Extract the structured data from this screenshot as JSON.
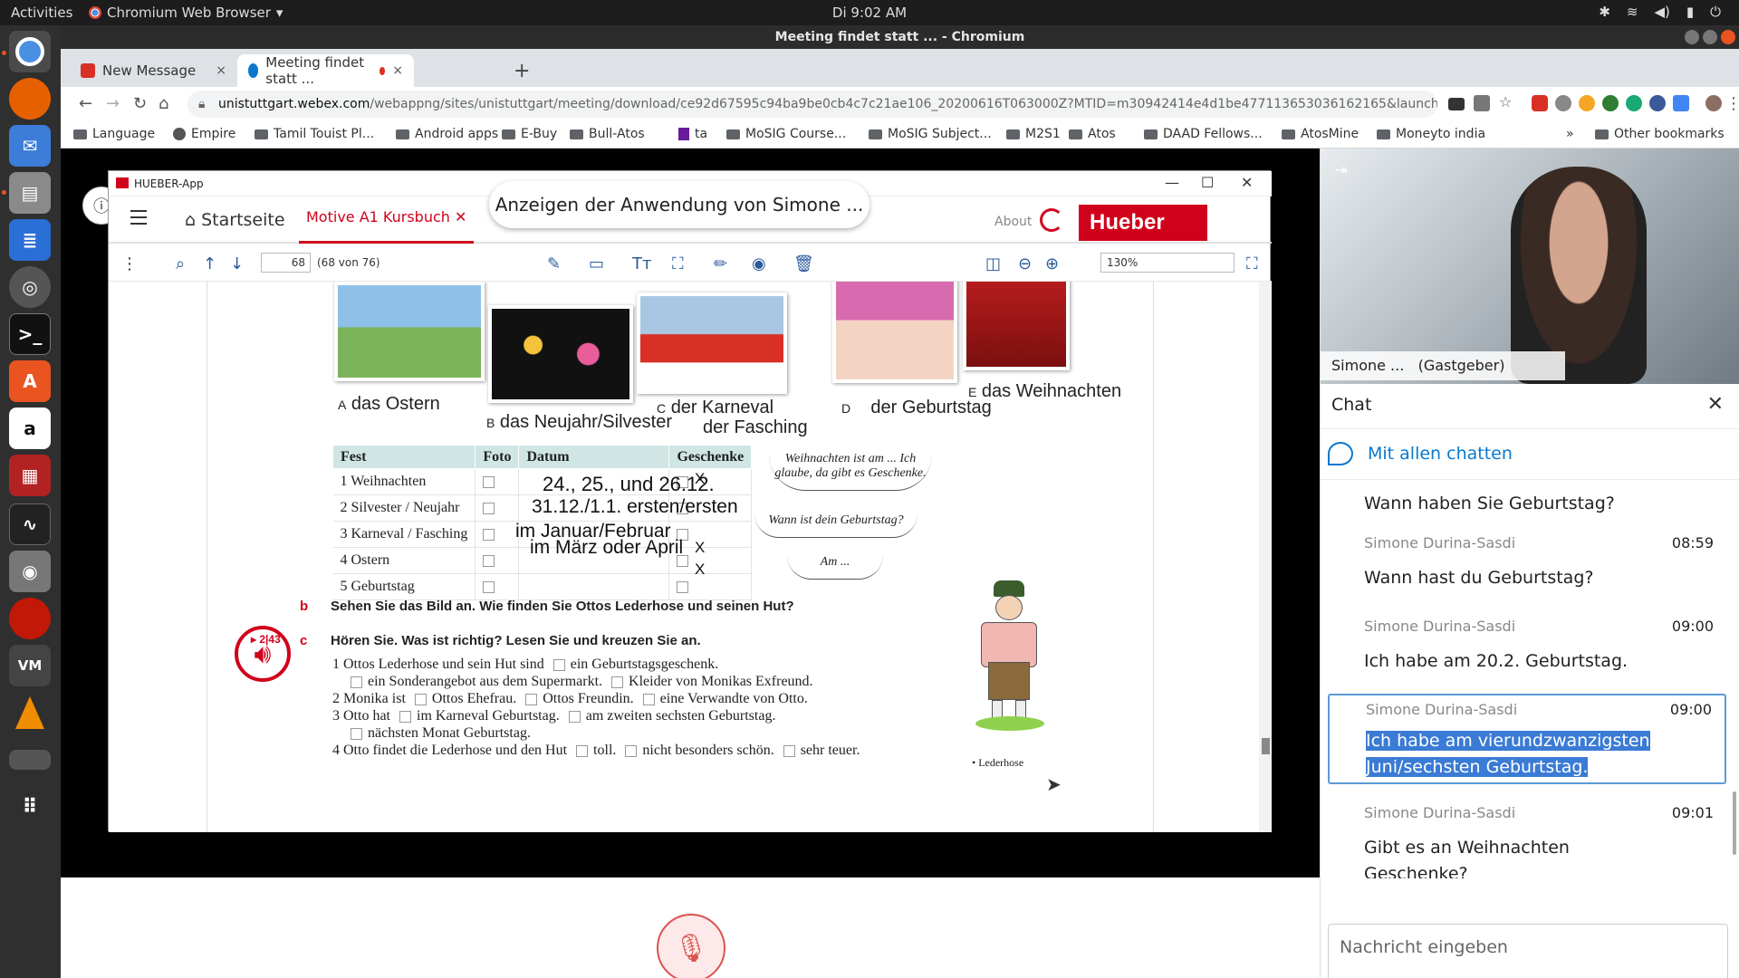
{
  "system": {
    "activities": "Activities",
    "app_menu": "Chromium Web Browser",
    "clock": "Di  9:02 AM"
  },
  "window": {
    "title": "Meeting findet statt ... - Chromium"
  },
  "tabs": [
    {
      "label": "New Message",
      "close": "×"
    },
    {
      "label": "Meeting findet statt ...",
      "close": "×"
    }
  ],
  "newtab": "+",
  "address": {
    "host": "unistuttgart.webex.com",
    "path": "/webappng/sites/unistuttgart/meeting/download/ce92d67595c94ba9be0cb4c7c21ae106_20200616T063000Z?MTID=m30942414e4d1be477113653036162165&launchApp..."
  },
  "bookmarks": [
    "Language",
    "Empire",
    "Tamil Touist Pl...",
    "Android apps",
    "E-Buy",
    "Bull-Atos",
    "ta",
    "MoSIG Course...",
    "MoSIG Subject...",
    "M2S1",
    "Atos",
    "DAAD Fellows...",
    "AtosMine",
    "Moneyto india"
  ],
  "bookmarks_more": "»",
  "other_bookmarks": "Other bookmarks",
  "share_banner": "Anzeigen der Anwendung von Simone ...",
  "hueber": {
    "title": "HUEBER-App",
    "home": "Startseite",
    "course": "Motive A1 Kursbuch",
    "about": "About",
    "brand": "Hueber",
    "page_number": "68",
    "page_of": "(68 von 76)",
    "zoom": "130%"
  },
  "doc": {
    "captions": [
      {
        "letter": "A",
        "text": "das Ostern"
      },
      {
        "letter": "B",
        "text": "das Neujahr/Silvester"
      },
      {
        "letter": "C",
        "text": "der Karneval"
      },
      {
        "letter": "",
        "text": "der Fasching"
      },
      {
        "letter": "D",
        "text": "der Geburtstag"
      },
      {
        "letter": "E",
        "text": "das Weihnachten"
      }
    ],
    "table_headers": [
      "Fest",
      "Foto",
      "Datum",
      "Geschenke"
    ],
    "table_rows": [
      {
        "fest": "1  Weihnachten",
        "datum": "24., 25., und 26.12.",
        "geschenke": "X"
      },
      {
        "fest": "2  Silvester / Neujahr",
        "datum": "31.12./1.1. ersten/ersten",
        "geschenke": ""
      },
      {
        "fest": "3  Karneval / Fasching",
        "datum": "im Januar/Februar",
        "geschenke": ""
      },
      {
        "fest": "4  Ostern",
        "datum": "im März oder April",
        "geschenke": "X"
      },
      {
        "fest": "5  Geburtstag",
        "datum": "",
        "geschenke": "X"
      }
    ],
    "bubbles": [
      "Weihnachten ist am ... Ich glaube, da gibt es Geschenke.",
      "Wann ist dein Geburtstag?",
      "Am ..."
    ],
    "task_b_letter": "b",
    "task_b": "Sehen Sie das Bild an. Wie finden Sie Ottos Lederhose und seinen Hut?",
    "task_c_track": "▸ 2|43",
    "task_c_letter": "c",
    "task_c": "Hören Sie. Was ist richtig? Lesen Sie und kreuzen Sie an.",
    "q1": "1  Ottos Lederhose und sein Hut sind",
    "q1a": "ein Geburtstagsgeschenk.",
    "q1b": "ein Sonderangebot aus dem Supermarkt.",
    "q1c": "Kleider von Monikas Exfreund.",
    "q2": "2  Monika ist",
    "q2a": "Ottos Ehefrau.",
    "q2b": "Ottos Freundin.",
    "q2c": "eine Verwandte von Otto.",
    "q3": "3  Otto hat",
    "q3a": "im Karneval Geburtstag.",
    "q3b": "am zweiten sechsten Geburtstag.",
    "q3c": "nächsten Monat Geburtstag.",
    "q4": "4  Otto findet die Lederhose und den Hut",
    "q4a": "toll.",
    "q4b": "nicht besonders schön.",
    "q4c": "sehr teuer.",
    "figure_label": "• Lederhose"
  },
  "video": {
    "name": "Simone ...",
    "role": "(Gastgeber)"
  },
  "chat": {
    "title": "Chat",
    "to": "Mit allen chatten",
    "messages": [
      {
        "from": "",
        "time": "",
        "text": "Wann haben Sie Geburtstag?"
      },
      {
        "from": "Simone Durina-Sasdi",
        "time": "08:59",
        "text": "Wann hast du Geburtstag?"
      },
      {
        "from": "Simone Durina-Sasdi",
        "time": "09:00",
        "text": "Ich habe am 20.2. Geburtstag."
      },
      {
        "from": "Simone Durina-Sasdi",
        "time": "09:00",
        "text": "Ich habe am vierundzwanzigsten Juni/sechsten Geburtstag."
      },
      {
        "from": "Simone Durina-Sasdi",
        "time": "09:01",
        "text": "Gibt es an Weihnachten Geschenke?"
      }
    ],
    "placeholder": "Nachricht eingeben"
  },
  "colors": {
    "hueber_red": "#d0021b",
    "webex_blue": "#0a78cc",
    "ubuntu_orange": "#e95420"
  }
}
